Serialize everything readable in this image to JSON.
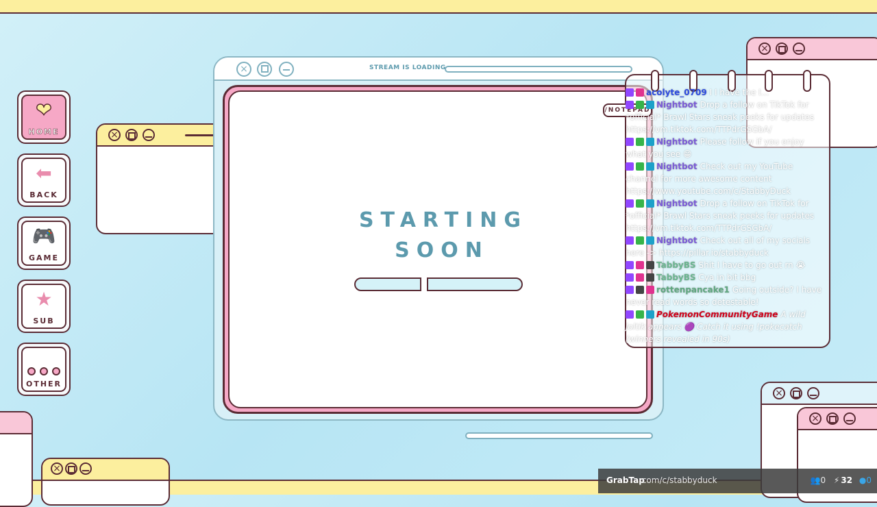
{
  "sidebar": {
    "items": [
      {
        "label": "HOME",
        "icon": "heart-icon"
      },
      {
        "label": "BACK",
        "icon": "arrow-left-icon"
      },
      {
        "label": "GAME",
        "icon": "gamepad-icon"
      },
      {
        "label": "SUB",
        "icon": "star-icon"
      },
      {
        "label": "OTHER",
        "icon": "dots-icon"
      }
    ]
  },
  "main_window": {
    "loading_label": "STREAM IS LOADING",
    "headline_1": "STARTING",
    "headline_2": "SOON"
  },
  "notepad": {
    "tab_label": "/NOTEPAD"
  },
  "chat": {
    "messages": [
      {
        "user": "acolyte_0709",
        "text": "I I have the I..."
      },
      {
        "user": "Nightbot",
        "text": "Drop a follow on TikTok for *official* Brawl Stars sneak peeks for updates https://vm.tiktok.com/TTPdrGSGbA/"
      },
      {
        "user": "Nightbot",
        "text": "Please follow if you enjoy what you see 😁"
      },
      {
        "user": "Nightbot",
        "text": "Check out my YouTube channel for more awesome content https://www.youtube.com/c/StabbyDuck"
      },
      {
        "user": "Nightbot",
        "text": "Drop a follow on TikTok for *official* Brawl Stars sneak peeks for updates https://vm.tiktok.com/TTPdrGSGbA/"
      },
      {
        "user": "Nightbot",
        "text": "Check out all of my socials here -> https://pillar.io/stabbyduck"
      },
      {
        "user": "TabbyBS",
        "text": "Shit I have to go out rn 😭"
      },
      {
        "user": "TabbyBS",
        "text": "Cya in bit bbg"
      },
      {
        "user": "rottenpancake1",
        "text": "Going outside? I have never read words so detestable!"
      },
      {
        "user": "PokemonCommunityGame",
        "text": "A wild Joltik appears 🟣 Catch it using !pokecatch (winners revealed in 90s)"
      }
    ]
  },
  "overlay": {
    "brand": "GrabTap",
    "link": ".com/c/stabbyduck",
    "viewers": "0",
    "points": "32",
    "extra": "0"
  },
  "colors": {
    "accent_pink": "#f6a8c6",
    "accent_yellow": "#fcef9e",
    "accent_teal": "#5c9aad",
    "outline": "#5a2b34"
  }
}
